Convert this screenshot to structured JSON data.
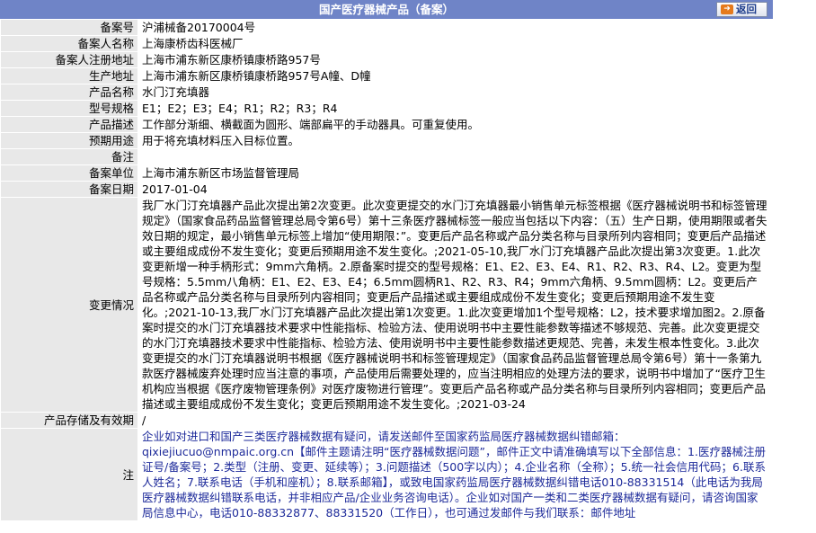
{
  "header": {
    "title": "国产医疗器械产品（备案）",
    "back_label": "返回"
  },
  "rows": [
    {
      "label": "备案号",
      "value": "沪浦械备20170004号"
    },
    {
      "label": "备案人名称",
      "value": "上海康桥齿科医械厂"
    },
    {
      "label": "备案人注册地址",
      "value": "上海市浦东新区康桥镇康桥路957号"
    },
    {
      "label": "生产地址",
      "value": "上海市浦东新区康桥镇康桥路957号A幢、D幢"
    },
    {
      "label": "产品名称",
      "value": "水门汀充填器"
    },
    {
      "label": "型号规格",
      "value": "E1；E2；E3；E4；R1；R2；R3；R4"
    },
    {
      "label": "产品描述",
      "value": "工作部分渐细、横截面为圆形、端部扁平的手动器具。可重复使用。"
    },
    {
      "label": "预期用途",
      "value": "用于将充填材料压入目标位置。"
    },
    {
      "label": "备注",
      "value": ""
    },
    {
      "label": "备案单位",
      "value": "上海市浦东新区市场监督管理局"
    },
    {
      "label": "备案日期",
      "value": "2017-01-04"
    }
  ],
  "change": {
    "label": "变更情况",
    "value": "我厂水门汀充填器产品此次提出第2次变更。此次变更提交的水门汀充填器最小销售单元标签根据《医疗器械说明书和标签管理规定》（国家食品药品监督管理总局令第6号）第十三条医疗器械标签一般应当包括以下内容：（五）生产日期，使用期限或者失效日期的规定，最小销售单元标签上增加“使用期限：”。变更后产品名称或产品分类名称与目录所列内容相同；变更后产品描述或主要组成成份不发生变化；变更后预期用途不发生变化。;2021-05-10,我厂水门汀充填器产品此次提出第3次变更。1.此次变更新增一种手柄形式：9mm六角柄。2.原备案时提交的型号规格：E1、E2、E3、E4、R1、R2、R3、R4、L2。变更为型号规格：5.5mm八角柄：E1、E2、E3、E4；6.5mm圆柄R1、R2、R3、R4；9mm六角柄、9.5mm圆柄：L2。变更后产品名称或产品分类名称与目录所列内容相同；变更后产品描述或主要组成成份不发生变化；变更后预期用途不发生变化。;2021-10-13,我厂水门汀充填器产品此次提出第1次变更。1.此次变更增加1个型号规格：L2，技术要求增加图2。2.原备案时提交的水门汀充填器技术要求中性能指标、检验方法、使用说明书中主要性能参数等描述不够规范、完善。此次变更提交的水门汀充填器技术要求中性能指标、检验方法、使用说明书中主要性能参数描述更规范、完善，未发生根本性变化。3.此次变更提交的水门汀充填器说明书根据《医疗器械说明书和标签管理规定》（国家食品药品监督管理总局令第6号）第十一条第九款医疗器械废弃处理时应当注意的事项，产品使用后需要处理的，应当注明相应的处理方法的要求，说明书中增加了“医疗卫生机构应当根据《医疗废物管理条例》对医疗废物进行管理”。变更后产品名称或产品分类名称与目录所列内容相同；变更后产品描述或主要组成成份不发生变化；变更后预期用途不发生变化。;2021-03-24"
  },
  "storage": {
    "label": "产品存储及有效期",
    "value": "/"
  },
  "note": {
    "label": "注",
    "value": "企业如对进口和国产三类医疗器械数据有疑问，请发送邮件至国家药监局医疗器械数据纠错邮箱：qixiejiucuo@nmpaic.org.cn【邮件主题请注明“医疗器械数据问题”，邮件正文中请准确填写以下全部信息：1.医疗器械注册证号/备案号；2.类型（注册、变更、延续等）；3.问题描述（500字以内）；4.企业名称（全称）；5.统一社会信用代码；6.联系人姓名；7.联系电话（手机和座机）；8.联系邮箱】，或致电国家药监局医疗器械数据纠错电话010-88331514（此电话为我局医疗器械数据纠错联系电话，并非相应产品/企业业务咨询电话）。企业如对国产一类和二类医疗器械数据有疑问，请咨询国家局信息中心，电话010-88332877、88331520（工作日），也可通过发邮件与我们联系：邮件地址"
  }
}
